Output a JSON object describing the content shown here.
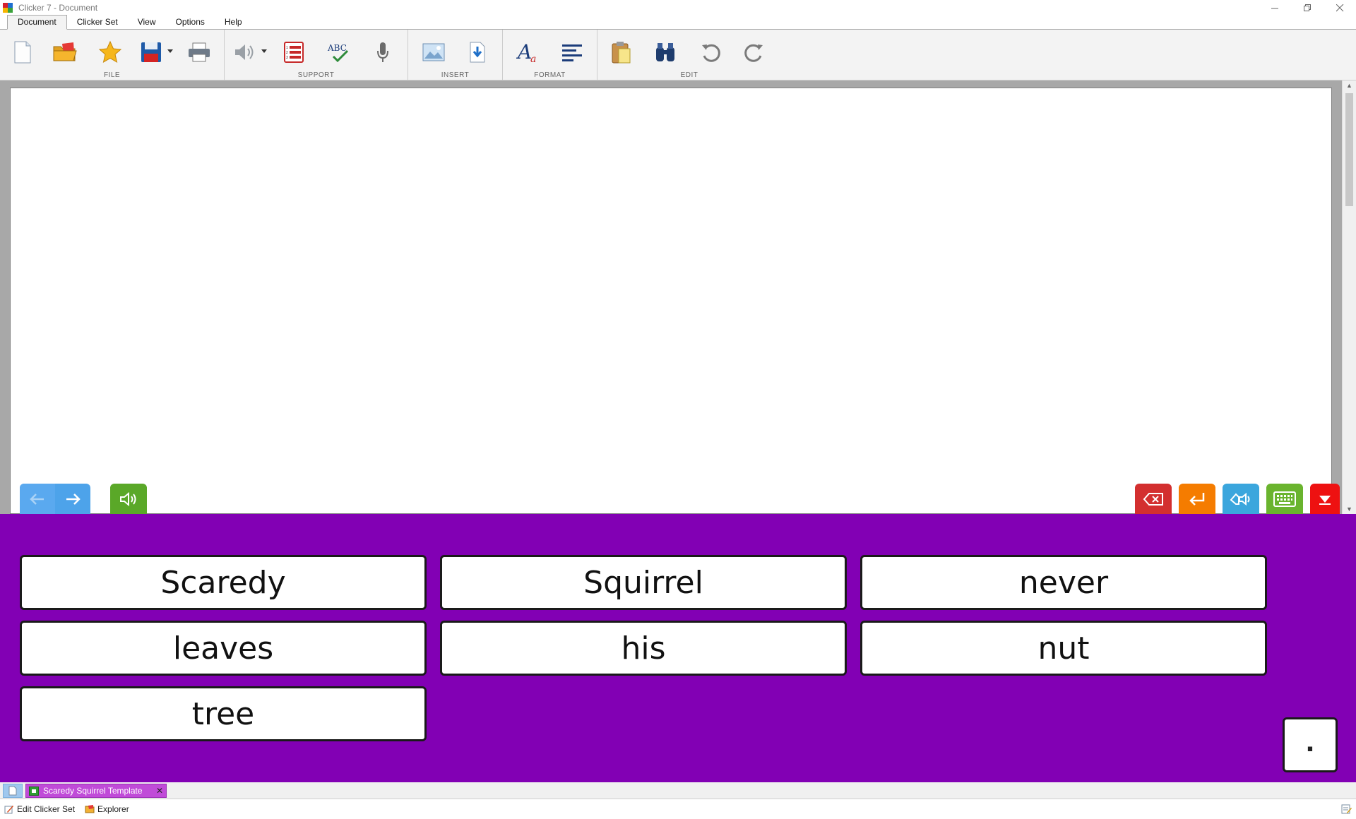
{
  "window": {
    "title": "Clicker 7 - Document"
  },
  "menu": {
    "tabs": [
      "Document",
      "Clicker Set",
      "View",
      "Options",
      "Help"
    ]
  },
  "ribbon": {
    "groups": {
      "file": "FILE",
      "support": "SUPPORT",
      "insert": "INSERT",
      "format": "FORMAT",
      "edit": "EDIT"
    }
  },
  "grid": {
    "background": "#8200b4",
    "cells": [
      "Scaredy",
      "Squirrel",
      "never",
      "leaves",
      "his",
      "nut",
      "tree"
    ],
    "punctuation": "."
  },
  "tabs": {
    "clicker_set": "Scaredy Squirrel Template"
  },
  "statusbar": {
    "edit_clicker_set": "Edit Clicker Set",
    "explorer": "Explorer"
  },
  "colors": {
    "nav_blue": "#4da3ea",
    "speak_green": "#5aa828",
    "delete_red": "#d32f2f",
    "enter_orange": "#f57c00",
    "speak_all_blue": "#3ba6dd",
    "keyboard_green": "#6ab42e",
    "minimize_red": "#ee1111"
  },
  "icons": [
    "new-document-icon",
    "open-folder-icon",
    "favorite-star-icon",
    "save-icon",
    "print-icon",
    "speech-icon",
    "word-list-icon",
    "spell-check-icon",
    "microphone-icon",
    "insert-picture-icon",
    "insert-clip-icon",
    "font-icon",
    "align-icon",
    "paste-icon",
    "find-icon",
    "undo-icon",
    "redo-icon"
  ]
}
